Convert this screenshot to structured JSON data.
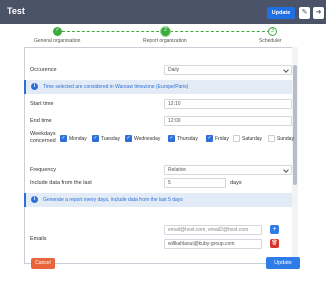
{
  "header": {
    "title": "Test",
    "update_label": "Update",
    "edit_icon": "pencil-icon",
    "back_icon": "arrow-left-icon"
  },
  "stepper": {
    "steps": [
      {
        "label": "General organisation",
        "state": "done",
        "marker": "✓"
      },
      {
        "label": "Report organization",
        "state": "current",
        "marker": "2"
      },
      {
        "label": "Scheduler",
        "state": "next",
        "marker": "3"
      }
    ],
    "accent": "#3daa3d"
  },
  "form": {
    "occurence": {
      "label": "Occurence",
      "value": "Daily"
    },
    "timezone_info": "Time selected are considered in Warsaw timezone (Europe/Paris)",
    "start_time": {
      "label": "Start time",
      "value": "12:10"
    },
    "end_time": {
      "label": "End time",
      "value": "12:00"
    },
    "weekdays": {
      "label_line1": "Weekdays",
      "label_line2": "concerned",
      "days": [
        {
          "label": "Monday",
          "checked": true
        },
        {
          "label": "Tuesday",
          "checked": true
        },
        {
          "label": "Wednesday",
          "checked": true
        },
        {
          "label": "Thursday",
          "checked": true
        },
        {
          "label": "Friday",
          "checked": true
        },
        {
          "label": "Saturday",
          "checked": false
        },
        {
          "label": "Sunday",
          "checked": false
        }
      ]
    },
    "frequency": {
      "label": "Frequency",
      "value": "Relative"
    },
    "include_from": {
      "label": "Include data from the last",
      "value": "5",
      "unit": "days"
    },
    "generate_info": "Generate a report every days, include data from the last 5 days",
    "emails": {
      "label": "Emails",
      "placeholder": "email@host.com, email2@host.com",
      "entries": [
        "willkahlaoui@kuby-group.com"
      ],
      "add_icon": "plus-icon",
      "delete_icon": "trash-icon"
    }
  },
  "footer": {
    "cancel_label": "Cancel",
    "update_label": "Update"
  },
  "colors": {
    "header_bg": "#4a5368",
    "primary": "#2d7ce8",
    "danger": "#e8643a",
    "delete": "#d9342b",
    "info_bg": "#e3ebf7"
  }
}
